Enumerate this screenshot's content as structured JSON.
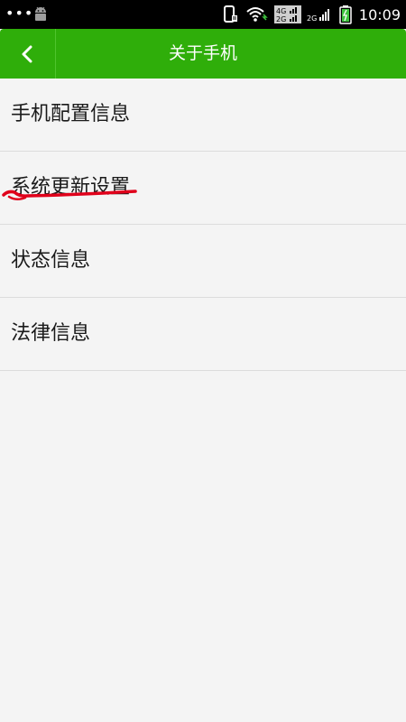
{
  "status_bar": {
    "overflow_dots": "•••",
    "time": "10:09",
    "network_labels": [
      "4G",
      "2G",
      "2G"
    ],
    "icons": [
      "android-icon",
      "phone-vibrate-icon",
      "wifi-icon",
      "signal-icon",
      "battery-charging-icon"
    ]
  },
  "app_bar": {
    "title": "关于手机",
    "back_icon": "chevron-left-icon",
    "color": "#2fae0a"
  },
  "menu": {
    "items": [
      {
        "label": "手机配置信息"
      },
      {
        "label": "系统更新设置",
        "annotated": true
      },
      {
        "label": "状态信息"
      },
      {
        "label": "法律信息"
      }
    ]
  },
  "colors": {
    "accent": "#2fae0a",
    "annotation": "#e0001b",
    "background": "#f4f4f4"
  }
}
